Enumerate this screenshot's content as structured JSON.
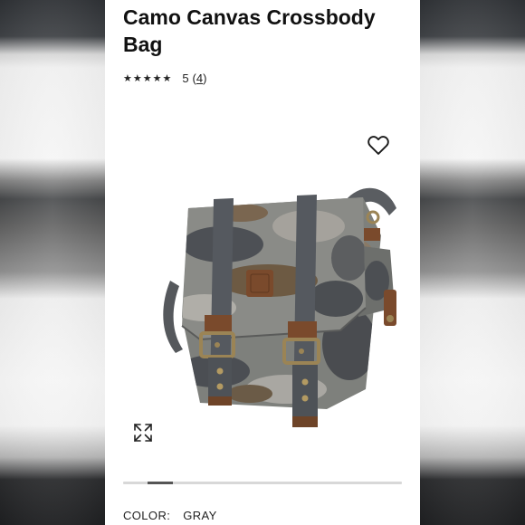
{
  "product": {
    "title": "Camo Canvas Crossbody Bag",
    "stars": "★★★★★",
    "rating_value": "5",
    "review_count_open": "(",
    "review_count": "4",
    "review_count_close": ")"
  },
  "icons": {
    "favorite": "heart-icon",
    "expand": "expand-icon"
  },
  "gallery": {
    "image_alt": "gray camo canvas messenger bag with brown leather straps",
    "scroll_position": 0.12
  },
  "attributes": {
    "color_label": "COLOR:",
    "color_value": "GRAY"
  },
  "colors": {
    "text": "#111111",
    "camo_gray": "#7d7f7c",
    "camo_dark": "#4a4d52",
    "leather": "#7a4a2c"
  }
}
